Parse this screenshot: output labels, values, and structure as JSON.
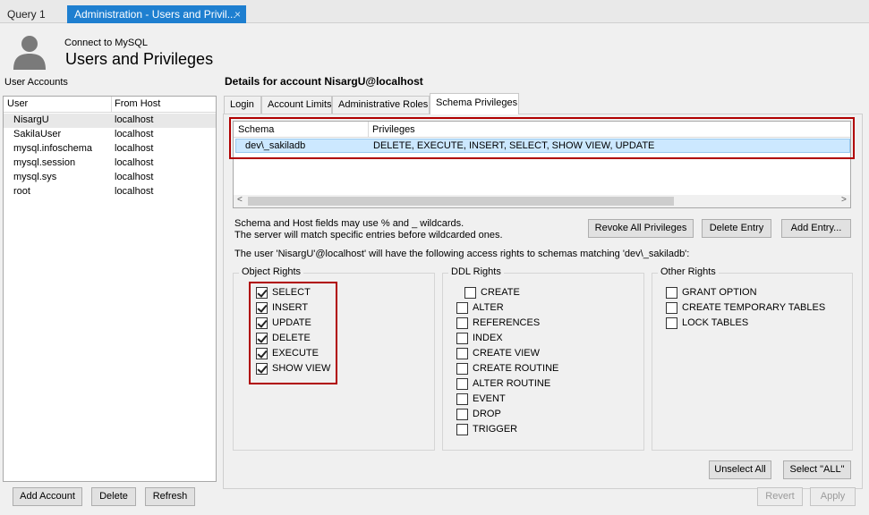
{
  "tabs": [
    {
      "label": "Query 1"
    },
    {
      "label": "Administration - Users and Privil...",
      "close": "×"
    }
  ],
  "header": {
    "connect": "Connect to MySQL",
    "title": "Users and Privileges"
  },
  "user_accounts": {
    "label": "User Accounts",
    "columns": [
      "User",
      "From Host"
    ],
    "rows": [
      {
        "user": "NisargU",
        "host": "localhost"
      },
      {
        "user": "SakilaUser",
        "host": "localhost"
      },
      {
        "user": "mysql.infoschema",
        "host": "localhost"
      },
      {
        "user": "mysql.session",
        "host": "localhost"
      },
      {
        "user": "mysql.sys",
        "host": "localhost"
      },
      {
        "user": "root",
        "host": "localhost"
      }
    ]
  },
  "details": {
    "title": "Details for account NisargU@localhost",
    "tabs": [
      "Login",
      "Account Limits",
      "Administrative Roles",
      "Schema Privileges"
    ]
  },
  "schema_grid": {
    "columns": [
      "Schema",
      "Privileges"
    ],
    "row": {
      "schema": "dev\\_sakiladb",
      "privileges": "DELETE, EXECUTE, INSERT, SELECT, SHOW VIEW, UPDATE"
    },
    "scroll_left": "<",
    "scroll_right": ">"
  },
  "info": {
    "line1": "Schema and Host fields may use % and _ wildcards.",
    "line2": "The server will match specific entries before wildcarded ones.",
    "access": "The user 'NisargU'@localhost' will have the following access rights to schemas matching 'dev\\_sakiladb':"
  },
  "buttons": {
    "revoke_all": "Revoke All Privileges",
    "delete_entry": "Delete Entry",
    "add_entry": "Add Entry...",
    "unselect_all": "Unselect All",
    "select_all": "Select \"ALL\"",
    "add_account": "Add Account",
    "delete": "Delete",
    "refresh": "Refresh",
    "revert": "Revert",
    "apply": "Apply"
  },
  "object_rights": {
    "title": "Object Rights",
    "items": [
      {
        "label": "SELECT",
        "checked": true
      },
      {
        "label": "INSERT",
        "checked": true
      },
      {
        "label": "UPDATE",
        "checked": true
      },
      {
        "label": "DELETE",
        "checked": true
      },
      {
        "label": "EXECUTE",
        "checked": true
      },
      {
        "label": "SHOW VIEW",
        "checked": true
      }
    ]
  },
  "ddl_rights": {
    "title": "DDL Rights",
    "items": [
      {
        "label": "CREATE",
        "checked": false
      },
      {
        "label": "ALTER",
        "checked": false
      },
      {
        "label": "REFERENCES",
        "checked": false
      },
      {
        "label": "INDEX",
        "checked": false
      },
      {
        "label": "CREATE VIEW",
        "checked": false
      },
      {
        "label": "CREATE ROUTINE",
        "checked": false
      },
      {
        "label": "ALTER ROUTINE",
        "checked": false
      },
      {
        "label": "EVENT",
        "checked": false
      },
      {
        "label": "DROP",
        "checked": false
      },
      {
        "label": "TRIGGER",
        "checked": false
      }
    ]
  },
  "other_rights": {
    "title": "Other Rights",
    "items": [
      {
        "label": "GRANT OPTION",
        "checked": false
      },
      {
        "label": "CREATE TEMPORARY TABLES",
        "checked": false
      },
      {
        "label": "LOCK TABLES",
        "checked": false
      }
    ]
  },
  "colors": {
    "accent": "#1e7fd0",
    "highlight": "#b00000",
    "selection": "#cce8ff"
  }
}
